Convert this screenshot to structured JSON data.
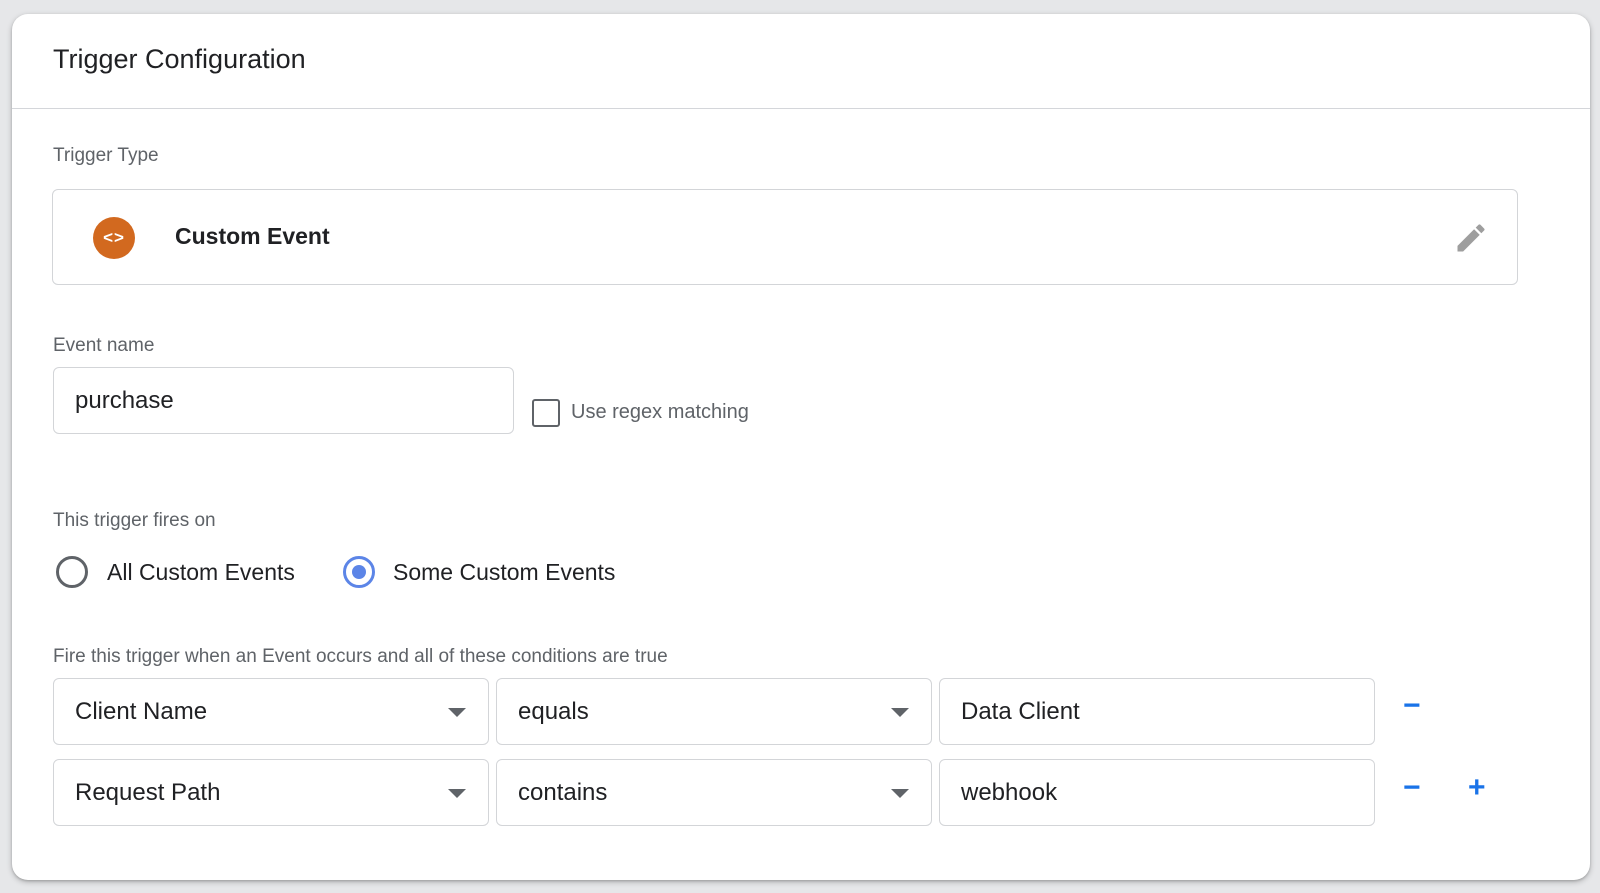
{
  "card": {
    "title": "Trigger Configuration"
  },
  "trigger_type": {
    "label": "Trigger Type",
    "name": "Custom Event",
    "icon": "code-brackets-icon",
    "icon_glyph": "<>",
    "icon_color": "#d2691f",
    "edit_icon": "pencil-icon"
  },
  "event_name": {
    "label": "Event name",
    "value": "purchase",
    "regex_label": "Use regex matching",
    "regex_checked": false
  },
  "fires_on": {
    "label": "This trigger fires on",
    "options": [
      {
        "label": "All Custom Events",
        "selected": false
      },
      {
        "label": "Some Custom Events",
        "selected": true
      }
    ],
    "accent_color": "#5c85e7"
  },
  "conditions": {
    "label": "Fire this trigger when an Event occurs and all of these conditions are true",
    "rows": [
      {
        "variable": "Client Name",
        "operator": "equals",
        "value": "Data Client",
        "remove_label": "−"
      },
      {
        "variable": "Request Path",
        "operator": "contains",
        "value": "webhook",
        "remove_label": "−",
        "add_label": "+"
      }
    ]
  }
}
